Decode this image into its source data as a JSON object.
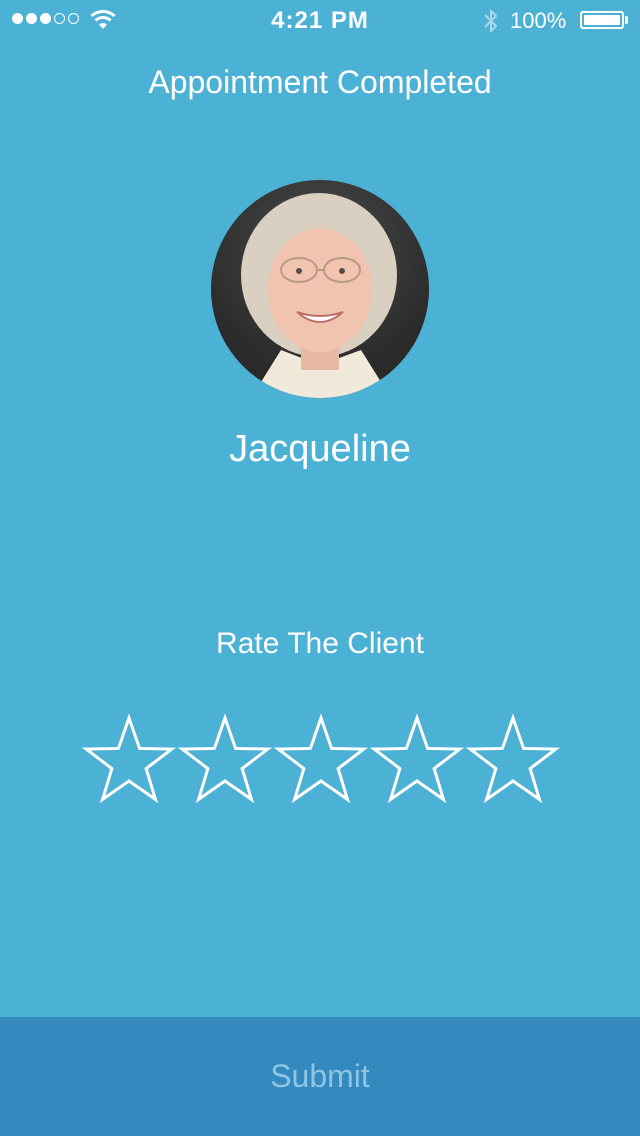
{
  "status_bar": {
    "signal_dots_filled": 3,
    "signal_dots_total": 5,
    "time": "4:21 PM",
    "battery_percent": "100%",
    "battery_level": 1.0
  },
  "header": {
    "title": "Appointment Completed"
  },
  "client": {
    "name": "Jacqueline"
  },
  "rating": {
    "label": "Rate The Client",
    "max_stars": 5,
    "selected_stars": 0
  },
  "footer": {
    "submit_label": "Submit"
  },
  "colors": {
    "background": "#4cb2d5",
    "submit_bar": "#3489be",
    "submit_text": "#8ec5e4",
    "foreground": "#ffffff"
  }
}
